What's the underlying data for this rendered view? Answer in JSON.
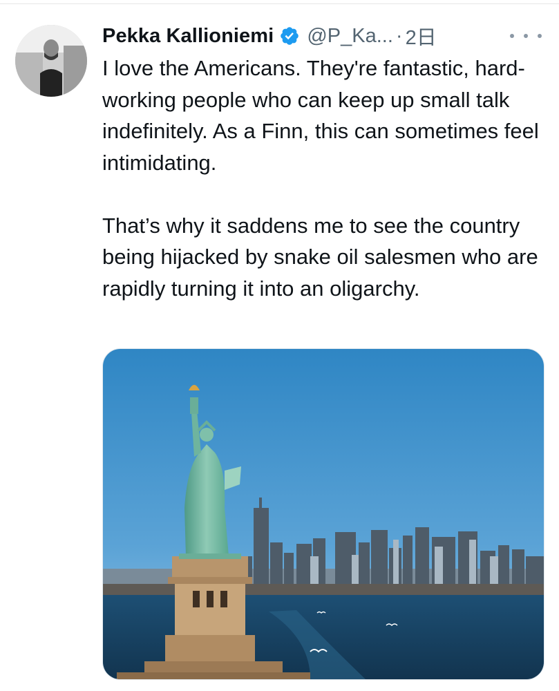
{
  "tweet": {
    "author_name": "Pekka Kallioniemi",
    "handle": "@P_Ka...",
    "separator": "·",
    "time": "2日",
    "verified": true,
    "verified_color": "#1d9bf0",
    "paragraphs": [
      "I love the Americans. They're fantastic, hard-working people who can keep up small talk indefinitely. As a Finn, this can sometimes feel intimidating.",
      "That’s why it saddens me to see the country being hijacked by snake oil salesmen who are rapidly turning it into an oligarchy."
    ],
    "media": {
      "subject": "Statue of Liberty with New York City skyline across the water"
    }
  },
  "icons": {
    "more": "more-horizontal-icon",
    "verified": "verified-badge-icon"
  },
  "colors": {
    "text": "#0f1419",
    "secondary": "#536471",
    "accent": "#1d9bf0"
  }
}
